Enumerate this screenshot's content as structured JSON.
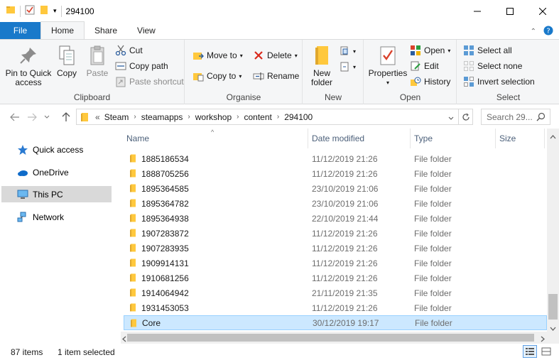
{
  "window": {
    "title": "294100"
  },
  "tabs": [
    "File",
    "Home",
    "Share",
    "View"
  ],
  "ribbon": {
    "clipboard": {
      "label": "Clipboard",
      "pin": "Pin to Quick\naccess",
      "pin_l1": "Pin to Quick",
      "pin_l2": "access",
      "copy": "Copy",
      "paste": "Paste",
      "cut": "Cut",
      "copy_path": "Copy path",
      "paste_shortcut": "Paste shortcut"
    },
    "organise": {
      "label": "Organise",
      "move_to": "Move to",
      "copy_to": "Copy to",
      "delete": "Delete",
      "rename": "Rename"
    },
    "new": {
      "label": "New",
      "new_folder_l1": "New",
      "new_folder_l2": "folder"
    },
    "open": {
      "label": "Open",
      "properties": "Properties",
      "open": "Open",
      "edit": "Edit",
      "history": "History"
    },
    "select": {
      "label": "Select",
      "select_all": "Select all",
      "select_none": "Select none",
      "invert": "Invert selection"
    }
  },
  "address": {
    "overflow": "«",
    "crumbs": [
      "Steam",
      "steamapps",
      "workshop",
      "content",
      "294100"
    ],
    "search_placeholder": "Search 29..."
  },
  "nav": {
    "items": [
      "Quick access",
      "OneDrive",
      "This PC",
      "Network"
    ]
  },
  "columns": {
    "name": "Name",
    "date": "Date modified",
    "type": "Type",
    "size": "Size"
  },
  "files": [
    {
      "name": "1885186534",
      "date": "11/12/2019 21:26",
      "type": "File folder"
    },
    {
      "name": "1888705256",
      "date": "11/12/2019 21:26",
      "type": "File folder"
    },
    {
      "name": "1895364585",
      "date": "23/10/2019 21:06",
      "type": "File folder"
    },
    {
      "name": "1895364782",
      "date": "23/10/2019 21:06",
      "type": "File folder"
    },
    {
      "name": "1895364938",
      "date": "22/10/2019 21:44",
      "type": "File folder"
    },
    {
      "name": "1907283872",
      "date": "11/12/2019 21:26",
      "type": "File folder"
    },
    {
      "name": "1907283935",
      "date": "11/12/2019 21:26",
      "type": "File folder"
    },
    {
      "name": "1909914131",
      "date": "11/12/2019 21:26",
      "type": "File folder"
    },
    {
      "name": "1910681256",
      "date": "11/12/2019 21:26",
      "type": "File folder"
    },
    {
      "name": "1914064942",
      "date": "21/11/2019 21:35",
      "type": "File folder"
    },
    {
      "name": "1931453053",
      "date": "11/12/2019 21:26",
      "type": "File folder"
    },
    {
      "name": "Core",
      "date": "30/12/2019 19:17",
      "type": "File folder"
    }
  ],
  "status": {
    "count": "87 items",
    "selected": "1 item selected"
  },
  "colors": {
    "file_tab": "#1979ca",
    "folder": "#ffc83d",
    "selection": "#cce8ff"
  }
}
